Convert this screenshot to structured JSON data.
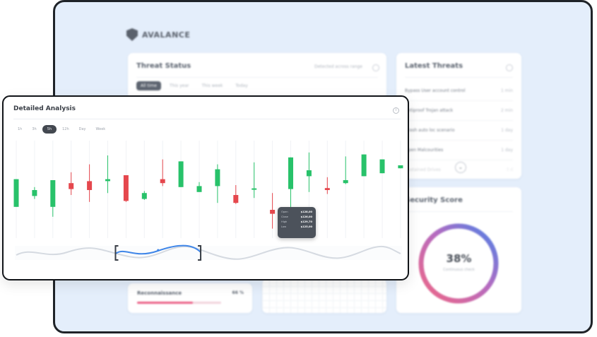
{
  "dashboard": {
    "brand": "AVALANCE",
    "threat_status": {
      "title": "Threat Status",
      "range_label": "Detected across range",
      "tabs": [
        {
          "label": "All time",
          "active": true
        },
        {
          "label": "This year",
          "active": false
        },
        {
          "label": "This week",
          "active": false
        },
        {
          "label": "Today",
          "active": false
        }
      ]
    },
    "latest_threats": {
      "title": "Latest Threats",
      "items": [
        {
          "label": "Bypass User account control",
          "time": "1 min"
        },
        {
          "label": "Antiproof Trojan attack",
          "time": "2 min"
        },
        {
          "label": "Crash auto loc scenario",
          "time": "1 day"
        },
        {
          "label": "Open Malcourities",
          "time": "1 day"
        },
        {
          "label": "Sustained Drives",
          "time": "3 d"
        }
      ],
      "more_icon": "chevron-down-icon"
    },
    "security_score": {
      "title": "Security Score",
      "value": "38%",
      "caption": "Continuous check",
      "percent": 0.38,
      "colors": {
        "track_start": "#f06785",
        "track_end": "#4a82e8"
      }
    },
    "reconnaissance": {
      "label": "Reconnaissance",
      "percent": "66 %",
      "fraction": 0.66,
      "color": "#ea5f86"
    }
  },
  "analysis": {
    "title": "Detailed Analysis",
    "timeframes": [
      {
        "label": "1h",
        "active": false
      },
      {
        "label": "3h",
        "active": false
      },
      {
        "label": "5h",
        "active": true
      },
      {
        "label": "12h",
        "active": false
      },
      {
        "label": "Day",
        "active": false
      },
      {
        "label": "Week",
        "active": false
      }
    ],
    "tooltip": [
      {
        "key": "Open",
        "value": "$128,00"
      },
      {
        "key": "Close",
        "value": "$126,00"
      },
      {
        "key": "High",
        "value": "$129,70"
      },
      {
        "key": "Low",
        "value": "$125,00"
      }
    ],
    "colors": {
      "up": "#28c26a",
      "down": "#e5474d",
      "navigator": "#3f86e8"
    }
  },
  "chart_data": {
    "type": "candlestick",
    "grid": true,
    "ylim": [
      0,
      100
    ],
    "candles": [
      {
        "open": 33,
        "close": 61,
        "high": 61,
        "low": 33,
        "dir": "up"
      },
      {
        "open": 44,
        "close": 50,
        "high": 53,
        "low": 41,
        "dir": "up"
      },
      {
        "open": 33,
        "close": 60,
        "high": 60,
        "low": 23,
        "dir": "up"
      },
      {
        "open": 57,
        "close": 51,
        "high": 68,
        "low": 45,
        "dir": "down"
      },
      {
        "open": 59,
        "close": 50,
        "high": 76,
        "low": 38,
        "dir": "down"
      },
      {
        "open": 59,
        "close": 61,
        "high": 85,
        "low": 47,
        "dir": "up"
      },
      {
        "open": 65,
        "close": 39,
        "high": 65,
        "low": 38,
        "dir": "down"
      },
      {
        "open": 41,
        "close": 47,
        "high": 49,
        "low": 40,
        "dir": "up"
      },
      {
        "open": 61,
        "close": 57,
        "high": 81,
        "low": 54,
        "dir": "down"
      },
      {
        "open": 53,
        "close": 79,
        "high": 79,
        "low": 53,
        "dir": "up"
      },
      {
        "open": 48,
        "close": 54,
        "high": 58,
        "low": 48,
        "dir": "up"
      },
      {
        "open": 54,
        "close": 71,
        "high": 76,
        "low": 37,
        "dir": "up"
      },
      {
        "open": 45,
        "close": 37,
        "high": 55,
        "low": 36,
        "dir": "down"
      },
      {
        "open": 51,
        "close": 51,
        "high": 78,
        "low": 42,
        "dir": "up"
      },
      {
        "open": 30,
        "close": 26,
        "high": 47,
        "low": 11,
        "dir": "down"
      },
      {
        "open": 51,
        "close": 83,
        "high": 83,
        "low": 27,
        "dir": "up"
      },
      {
        "open": 64,
        "close": 70,
        "high": 88,
        "low": 48,
        "dir": "up"
      },
      {
        "open": 52,
        "close": 50,
        "high": 63,
        "low": 46,
        "dir": "down"
      },
      {
        "open": 57,
        "close": 60,
        "high": 84,
        "low": 56,
        "dir": "up"
      },
      {
        "open": 64,
        "close": 86,
        "high": 86,
        "low": 64,
        "dir": "up"
      },
      {
        "open": 67,
        "close": 81,
        "high": 81,
        "low": 67,
        "dir": "up"
      },
      {
        "open": 72,
        "close": 75,
        "high": 75,
        "low": 72,
        "dir": "up"
      }
    ],
    "navigator": {
      "selected_start_fraction": 0.26,
      "selected_end_fraction": 0.48
    }
  }
}
